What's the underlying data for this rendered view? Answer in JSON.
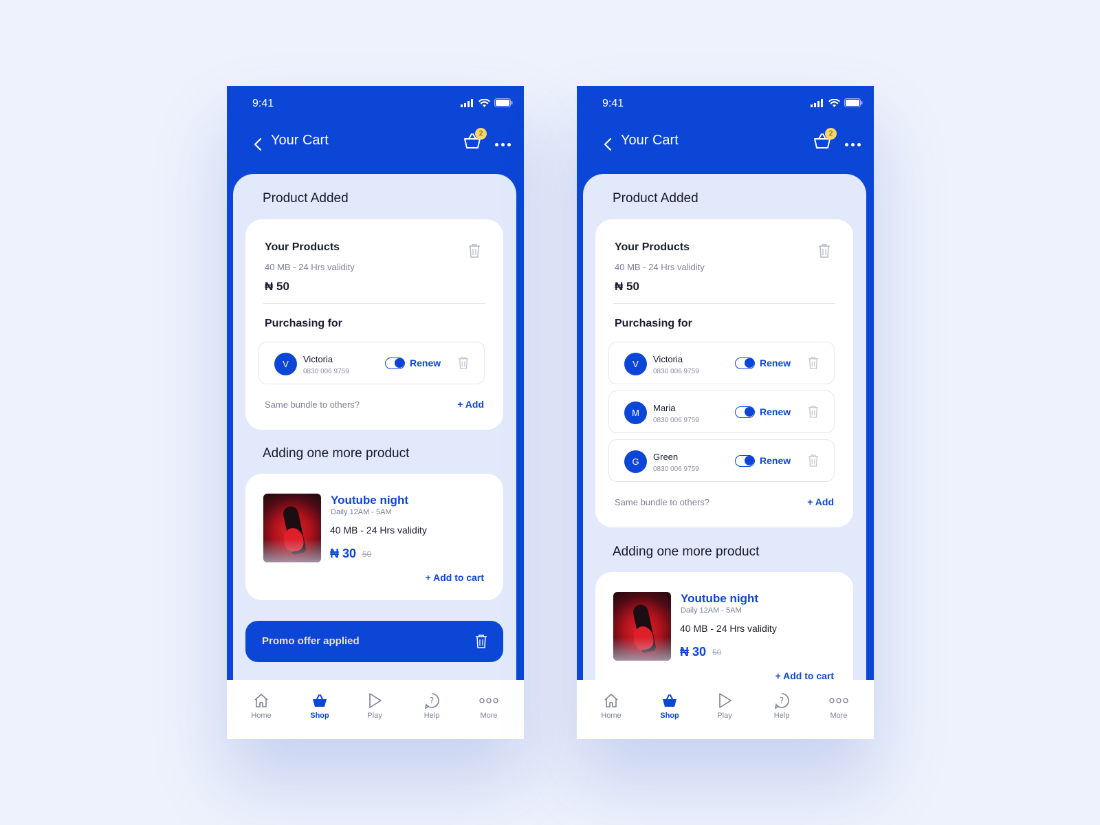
{
  "colors": {
    "primary": "#0b46d6",
    "badge": "#f8d66a",
    "sheet": "#e1e9fb",
    "promo_text": "#f5e2b0"
  },
  "status": {
    "time": "9:41"
  },
  "header": {
    "title": "Your Cart",
    "cart_count": "2"
  },
  "product_added": {
    "section_title": "Product Added",
    "products_title": "Your Products",
    "products_sub": "40 MB - 24 Hrs validity",
    "products_price": "₦ 50",
    "purchasing_for": "Purchasing for",
    "renew_label": "Renew",
    "same_bundle": "Same bundle to others?",
    "add_label": "+ Add"
  },
  "recipients_left": [
    {
      "initial": "V",
      "name": "Victoria",
      "phone": "0830 006 9759",
      "renew_on": true
    }
  ],
  "recipients_right": [
    {
      "initial": "V",
      "name": "Victoria",
      "phone": "0830 006 9759",
      "renew_on": true
    },
    {
      "initial": "M",
      "name": "Maria",
      "phone": "0830 006 9759",
      "renew_on": true
    },
    {
      "initial": "G",
      "name": "Green",
      "phone": "0830 006 9759",
      "renew_on": true
    }
  ],
  "more_product": {
    "section_title": "Adding one more product",
    "name": "Youtube night",
    "time": "Daily 12AM - 5AM",
    "desc": "40 MB - 24 Hrs validity",
    "price": "₦ 30",
    "old_price": "50",
    "add_to_cart": "+ Add to cart"
  },
  "promo": {
    "label": "Promo offer applied"
  },
  "tabs": [
    {
      "label": "Home",
      "icon": "home-icon",
      "active": false
    },
    {
      "label": "Shop",
      "icon": "basket-icon",
      "active": true
    },
    {
      "label": "Play",
      "icon": "play-icon",
      "active": false
    },
    {
      "label": "Help",
      "icon": "help-icon",
      "active": false
    },
    {
      "label": "More",
      "icon": "more-icon",
      "active": false
    }
  ]
}
